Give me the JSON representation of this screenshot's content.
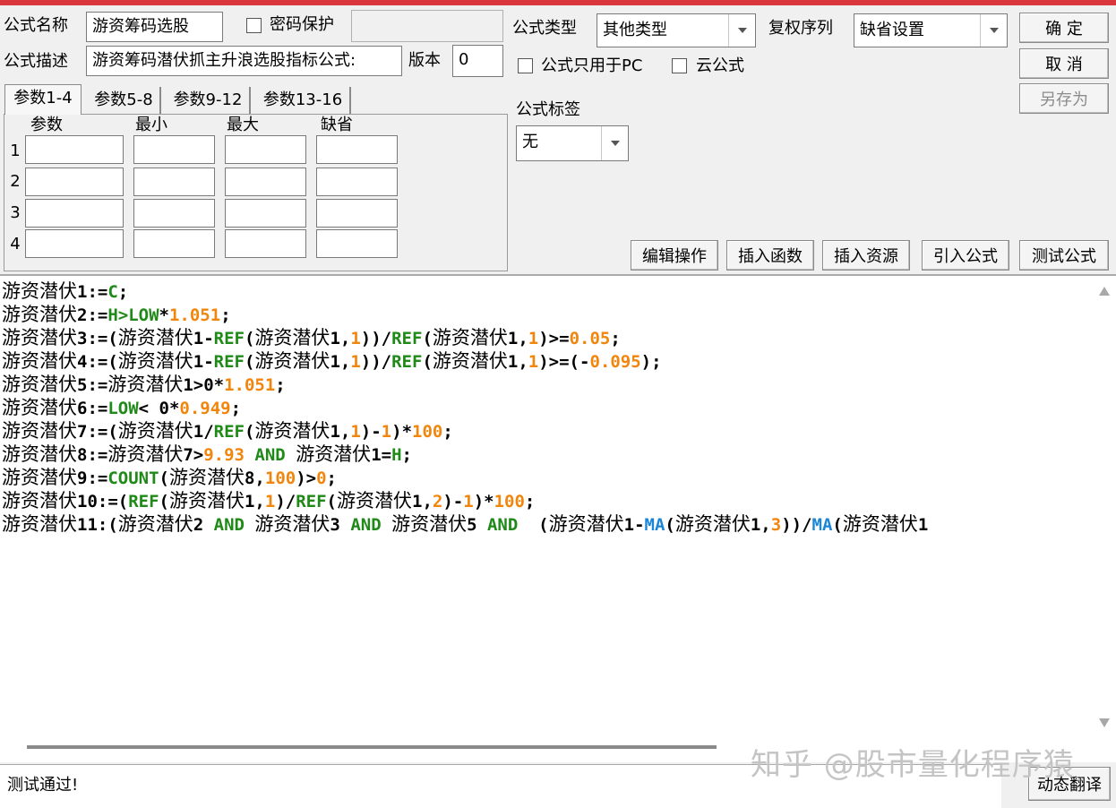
{
  "header": {
    "name_label": "公式名称",
    "name_value": "游资筹码选股",
    "password_label": "密码保护",
    "desc_label": "公式描述",
    "desc_value": "游资筹码潜伏抓主升浪选股指标公式:",
    "version_label": "版本",
    "version_value": "0",
    "type_label": "公式类型",
    "type_value": "其他类型",
    "restore_label": "复权序列",
    "restore_value": "缺省设置",
    "pc_only_label": "公式只用于PC",
    "cloud_label": "云公式",
    "tag_label": "公式标签",
    "tag_value": "无"
  },
  "buttons": {
    "ok": "确 定",
    "cancel": "取 消",
    "save_as": "另存为",
    "edit_ops": "编辑操作",
    "insert_func": "插入函数",
    "insert_res": "插入资源",
    "import_formula": "引入公式",
    "test_formula": "测试公式",
    "dynamic_translate": "动态翻译"
  },
  "params": {
    "tabs": [
      "参数1-4",
      "参数5-8",
      "参数9-12",
      "参数13-16"
    ],
    "columns": [
      "参数",
      "最小",
      "最大",
      "缺省"
    ],
    "rows": [
      "1",
      "2",
      "3",
      "4"
    ]
  },
  "code": {
    "l1": [
      "游资潜伏",
      "1:=",
      "C",
      ";"
    ],
    "l2": [
      "游资潜伏",
      "2:=",
      "H>LOW",
      "*",
      "1.051",
      ";"
    ],
    "l3": [
      "游资潜伏",
      "3:=(",
      "游资潜伏",
      "1-",
      "REF",
      "(",
      "游资潜伏",
      "1,",
      "1",
      "))/",
      "REF",
      "(",
      "游资潜伏",
      "1,",
      "1",
      ")>=",
      "0.05",
      ";"
    ],
    "l4": [
      "游资潜伏",
      "4:=(",
      "游资潜伏",
      "1-",
      "REF",
      "(",
      "游资潜伏",
      "1,",
      "1",
      "))/",
      "REF",
      "(",
      "游资潜伏",
      "1,",
      "1",
      ")>=(-",
      "0.095",
      ");"
    ],
    "l5": [
      "游资潜伏",
      "5:=",
      "游资潜伏",
      "1>0*",
      "1.051",
      ";"
    ],
    "l6": [
      "游资潜伏",
      "6:=",
      "LOW",
      "< 0*",
      "0.949",
      ";"
    ],
    "l7": [
      "游资潜伏",
      "7:=(",
      "游资潜伏",
      "1/",
      "REF",
      "(",
      "游资潜伏",
      "1,",
      "1",
      ")-",
      "1",
      ")*",
      "100",
      ";"
    ],
    "l8": [
      "游资潜伏",
      "8:=",
      "游资潜伏",
      "7>",
      "9.93",
      " AND ",
      "游资潜伏",
      "1=",
      "H",
      ";"
    ],
    "l9": [
      "游资潜伏",
      "9:=",
      "COUNT",
      "(",
      "游资潜伏",
      "8,",
      "100",
      ")>",
      "0",
      ";"
    ],
    "l10": [
      "游资潜伏",
      "10:=(",
      "REF",
      "(",
      "游资潜伏",
      "1,",
      "1",
      ")/",
      "REF",
      "(",
      "游资潜伏",
      "1,",
      "2",
      ")-",
      "1",
      ")*",
      "100",
      ";"
    ],
    "l11": [
      "游资潜伏",
      "11:(",
      "游资潜伏",
      "2",
      " AND ",
      "游资潜伏",
      "3",
      " AND ",
      "游资潜伏",
      "5",
      " AND ",
      " (",
      "游资潜伏",
      "1-",
      "MA",
      "(",
      "游资潜伏",
      "1,",
      "3",
      "))/",
      "MA",
      "(",
      "游资潜伏",
      "1"
    ]
  },
  "status_text": "测试通过!",
  "watermark": "知乎 @股市量化程序猿"
}
